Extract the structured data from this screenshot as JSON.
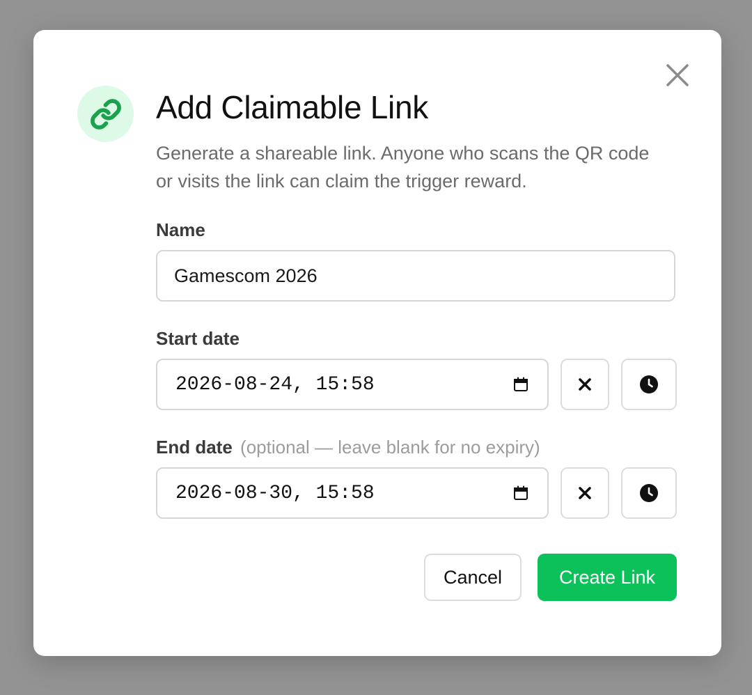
{
  "dialog": {
    "title": "Add Claimable Link",
    "description": "Generate a shareable link. Anyone who scans the QR code or visits the link can claim the trigger reward.",
    "icons": {
      "header": "link-icon",
      "close": "close-icon",
      "calendar": "calendar-icon",
      "clear": "clear-icon",
      "clock": "clock-icon"
    },
    "colors": {
      "accent": "#0cc15a",
      "icon_bg": "#dcfae6",
      "overlay": "#939393"
    }
  },
  "form": {
    "name": {
      "label": "Name",
      "value": "Gamescom 2026"
    },
    "start_date": {
      "label": "Start date",
      "value": "2026-08-24, 15:58"
    },
    "end_date": {
      "label": "End date",
      "hint": "(optional — leave blank for no expiry)",
      "value": "2026-08-30, 15:58"
    }
  },
  "actions": {
    "cancel_label": "Cancel",
    "create_label": "Create Link"
  }
}
